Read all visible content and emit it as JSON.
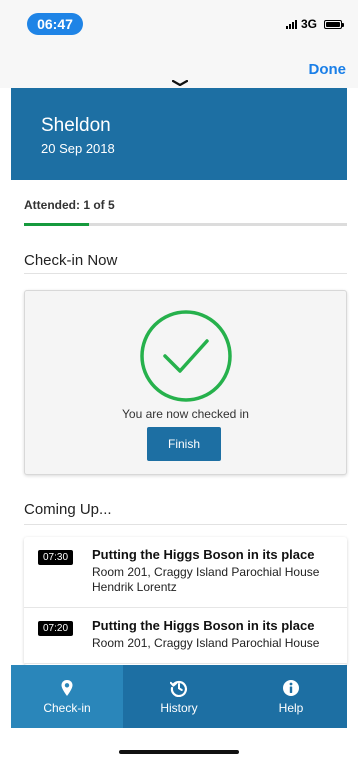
{
  "status_bar": {
    "time": "06:47",
    "network": "3G",
    "icons": [
      "signal-icon",
      "battery-icon"
    ]
  },
  "sheet": {
    "done_label": "Done",
    "grabber_icon": "chevron-down-icon"
  },
  "header": {
    "name": "Sheldon",
    "date": "20 Sep 2018"
  },
  "attendance": {
    "text": "Attended: 1 of 5",
    "progress_fraction": 0.2
  },
  "checkin": {
    "section_title": "Check-in Now",
    "message": "You are now checked in",
    "finish_label": "Finish",
    "icon": "check-circle-icon"
  },
  "coming_up": {
    "section_title": "Coming Up...",
    "sessions": [
      {
        "time": "07:30",
        "title": "Putting the Higgs Boson in its place",
        "room": "Room 201, Craggy Island Parochial House",
        "speaker": "Hendrik Lorentz"
      },
      {
        "time": "07:20",
        "title": "Putting the Higgs Boson in its place",
        "room": "Room 201, Craggy Island Parochial House",
        "speaker": ""
      }
    ]
  },
  "tabs": [
    {
      "label": "Check-in",
      "icon": "map-pin-icon",
      "active": true
    },
    {
      "label": "History",
      "icon": "history-icon",
      "active": false
    },
    {
      "label": "Help",
      "icon": "info-icon",
      "active": false
    }
  ],
  "colors": {
    "primary": "#1d6fa3",
    "active_tab": "#2a86ba",
    "success": "#26b14c",
    "progress": "#169a3d",
    "link": "#1a7fe8"
  }
}
